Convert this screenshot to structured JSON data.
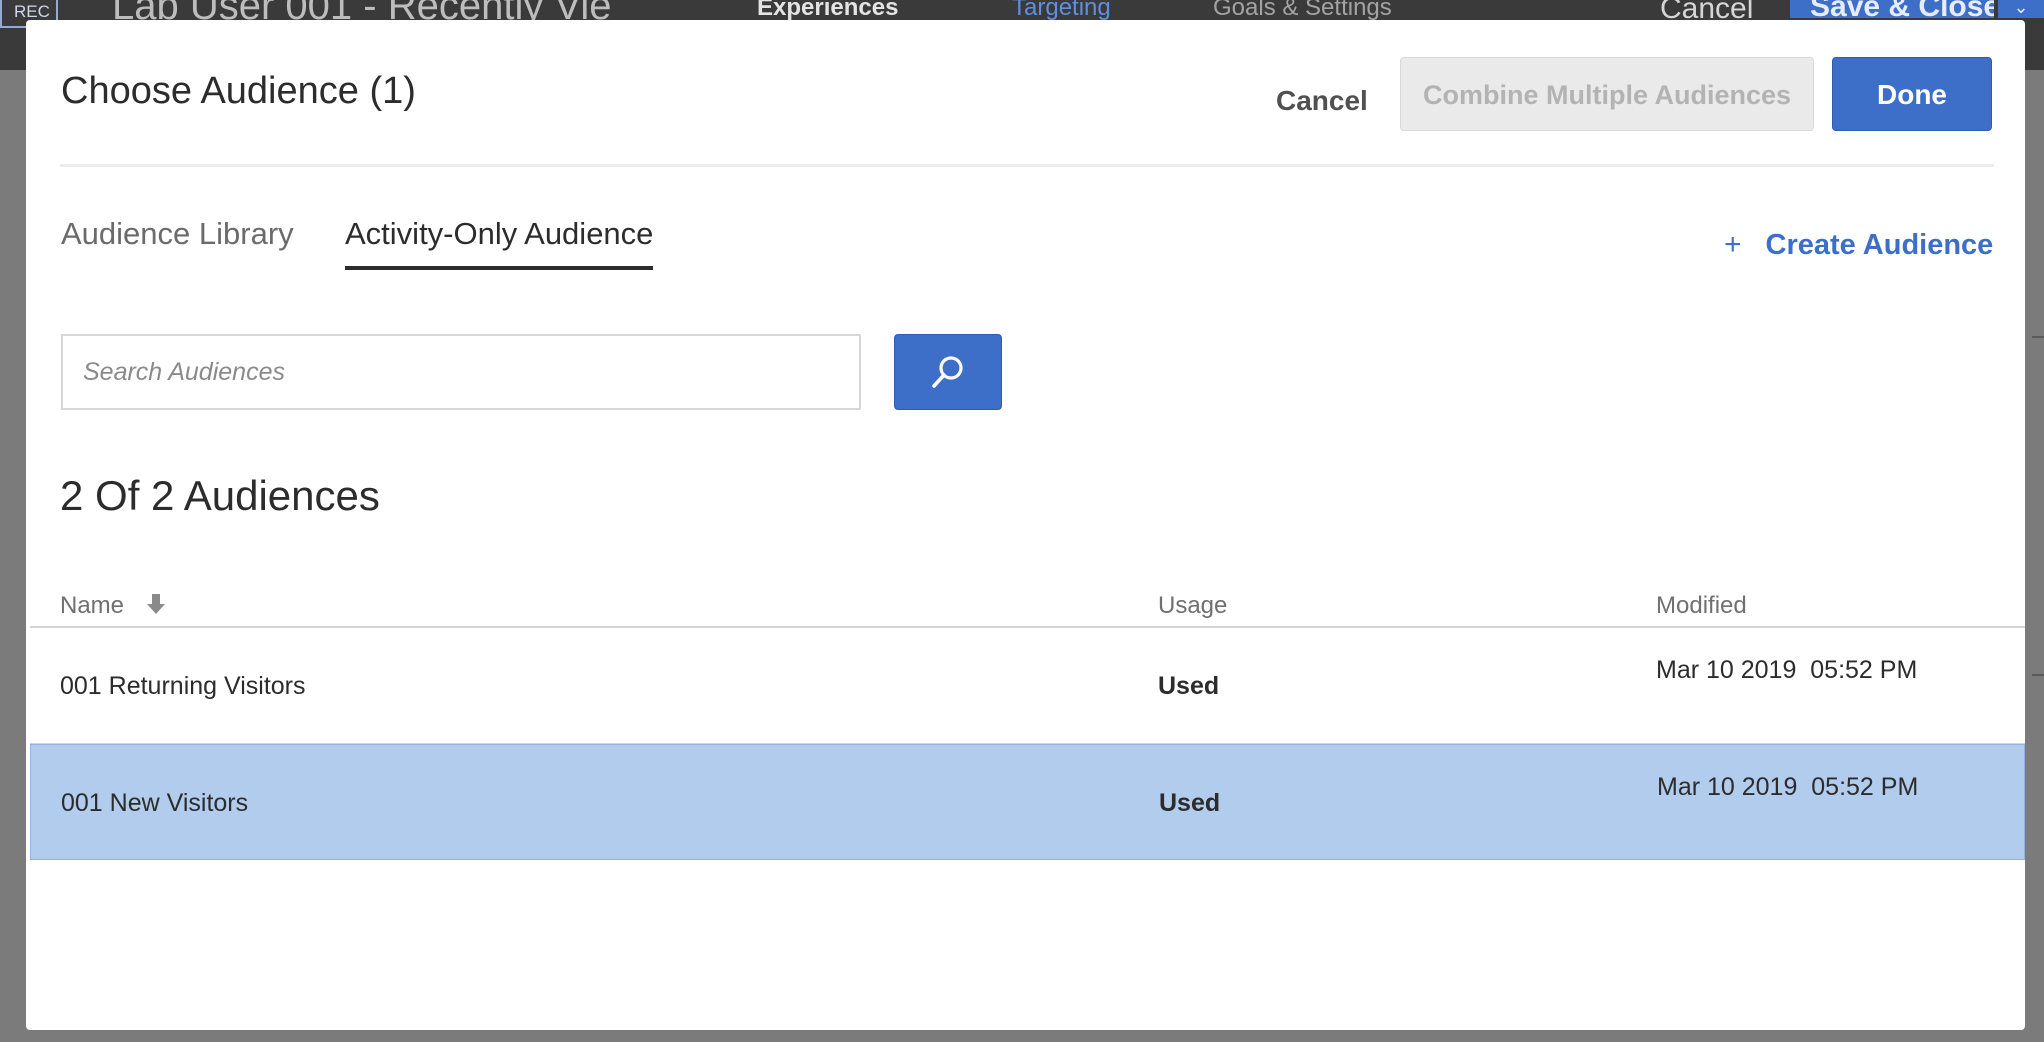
{
  "background": {
    "rec_label": "REC",
    "activity_title": "Lab User 001 - Recently Vie",
    "nav": [
      "Experiences",
      "Targeting",
      "Goals & Settings"
    ],
    "cancel_label": "Cancel",
    "save_close_label": "Save & Close"
  },
  "modal": {
    "title": "Choose Audience (1)",
    "cancel_label": "Cancel",
    "combine_label": "Combine Multiple Audiences",
    "done_label": "Done",
    "tabs": [
      {
        "label": "Audience Library",
        "active": false
      },
      {
        "label": "Activity-Only Audience",
        "active": true
      }
    ],
    "create_plus": "+",
    "create_label": "Create Audience",
    "search": {
      "placeholder": "Search Audiences",
      "value": ""
    },
    "count_label": "2 Of 2 Audiences",
    "columns": {
      "name": "Name",
      "usage": "Usage",
      "modified": "Modified"
    },
    "rows": [
      {
        "name": "001 Returning Visitors",
        "usage": "Used",
        "modified": "Mar 10 2019  05:52 PM",
        "selected": false
      },
      {
        "name": "001 New Visitors",
        "usage": "Used",
        "modified": "Mar 10 2019  05:52 PM",
        "selected": true
      }
    ]
  },
  "colors": {
    "accent": "#3d6fc9",
    "selected_row": "#b1cced",
    "overlay": "#7b7b7b"
  }
}
